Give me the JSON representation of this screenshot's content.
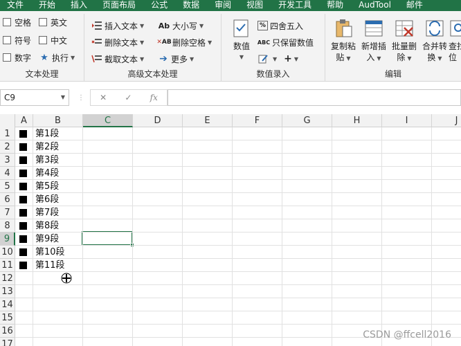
{
  "menu_tabs": [
    "文件",
    "开始",
    "插入",
    "页面布局",
    "公式",
    "数据",
    "审阅",
    "视图",
    "开发工具",
    "帮助",
    "AudTool",
    "邮件"
  ],
  "ribbon": {
    "text_group": {
      "label": "文本处理",
      "checkboxes": [
        "空格",
        "英文",
        "符号",
        "中文",
        "数字"
      ],
      "execute": "执行"
    },
    "advanced_group": {
      "label": "高级文本处理",
      "insert_text": "插入文本",
      "delete_text": "删除文本",
      "extract_text": "截取文本",
      "case": "大小写",
      "delete_space": "删除空格",
      "more": "更多"
    },
    "entry_group": {
      "label": "数值录入",
      "value_btn": "数值",
      "round": "四舍五入",
      "keep_value": "只保留数值",
      "plus": "+"
    },
    "edit_group": {
      "label": "编辑",
      "copy_paste": [
        "复制粘",
        "贴"
      ],
      "add_insert": [
        "新增插",
        "入"
      ],
      "batch_delete": [
        "批量删",
        "除"
      ],
      "merge_convert": [
        "合并转",
        "换"
      ],
      "find_locate": [
        "查找",
        "位"
      ]
    }
  },
  "formula_bar": {
    "name_box": "C9",
    "cancel": "✕",
    "confirm": "✓",
    "fx": "fx",
    "content": ""
  },
  "grid": {
    "columns": [
      "A",
      "B",
      "C",
      "D",
      "E",
      "F",
      "G",
      "H",
      "I",
      "J"
    ],
    "selected_column": "C",
    "rows": [
      "1",
      "2",
      "3",
      "4",
      "5",
      "6",
      "7",
      "8",
      "9",
      "10",
      "11",
      "12",
      "13",
      "14",
      "15",
      "16",
      "17"
    ],
    "selected_row": "9",
    "column_b_values": [
      "第1段",
      "第2段",
      "第3段",
      "第4段",
      "第5段",
      "第6段",
      "第7段",
      "第8段",
      "第9段",
      "第10段",
      "第11段"
    ],
    "column_a_marker": "■"
  },
  "watermark": "CSDN @ffcell2016",
  "colors": {
    "accent": "#217346"
  }
}
